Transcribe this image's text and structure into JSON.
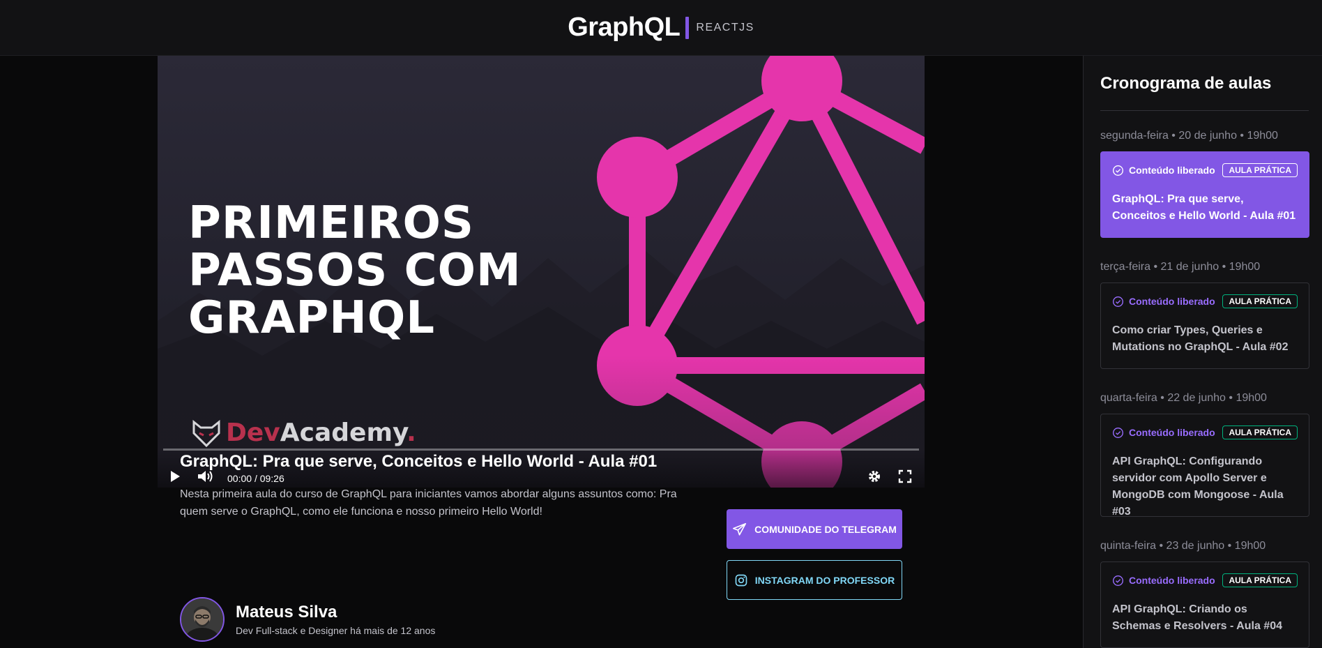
{
  "header": {
    "brand": "GraphQL",
    "subtitle": "REACTJS"
  },
  "video": {
    "title_lines": [
      "PRIMEIROS",
      "PASSOS COM",
      "GRAPHQL"
    ],
    "logo_dev": "Dev",
    "logo_academy": "Academy",
    "logo_dot": ".",
    "time_current": "00:00",
    "time_separator": "/",
    "time_total": "09:26",
    "progress": 0
  },
  "lesson": {
    "title": "GraphQL: Pra que serve, Conceitos e Hello World - Aula #01",
    "description": "Nesta primeira aula do curso de GraphQL para iniciantes vamos abordar alguns assuntos como: Pra quem serve o GraphQL, como ele funciona e nosso primeiro Hello World!"
  },
  "teacher": {
    "name": "Mateus Silva",
    "role": "Dev Full-stack e Designer há mais de 12 anos"
  },
  "buttons": {
    "telegram": "COMUNIDADE DO TELEGRAM",
    "instagram": "INSTAGRAM DO PROFESSOR"
  },
  "sidebar": {
    "title": "Cronograma de aulas",
    "lessons": [
      {
        "date": "segunda-feira • 20 de junho • 19h00",
        "status": "Conteúdo liberado",
        "tag": "AULA PRÁTICA",
        "title": "GraphQL: Pra que serve, Conceitos e Hello World - Aula #01",
        "active": true
      },
      {
        "date": "terça-feira • 21 de junho • 19h00",
        "status": "Conteúdo liberado",
        "tag": "AULA PRÁTICA",
        "title": "Como criar Types, Queries e Mutations no GraphQL - Aula #02",
        "active": false
      },
      {
        "date": "quarta-feira • 22 de junho • 19h00",
        "status": "Conteúdo liberado",
        "tag": "AULA PRÁTICA",
        "title": "API GraphQL: Configurando servidor com Apollo Server e MongoDB com Mongoose - Aula #03",
        "active": false
      },
      {
        "date": "quinta-feira • 23 de junho • 19h00",
        "status": "Conteúdo liberado",
        "tag": "AULA PRÁTICA",
        "title": "API GraphQL: Criando os Schemas e Resolvers - Aula #04",
        "active": false
      }
    ]
  },
  "colors": {
    "accent": "#8257e5",
    "graphql_pink": "#e535ab",
    "instagram_blue": "#81d8f7"
  }
}
